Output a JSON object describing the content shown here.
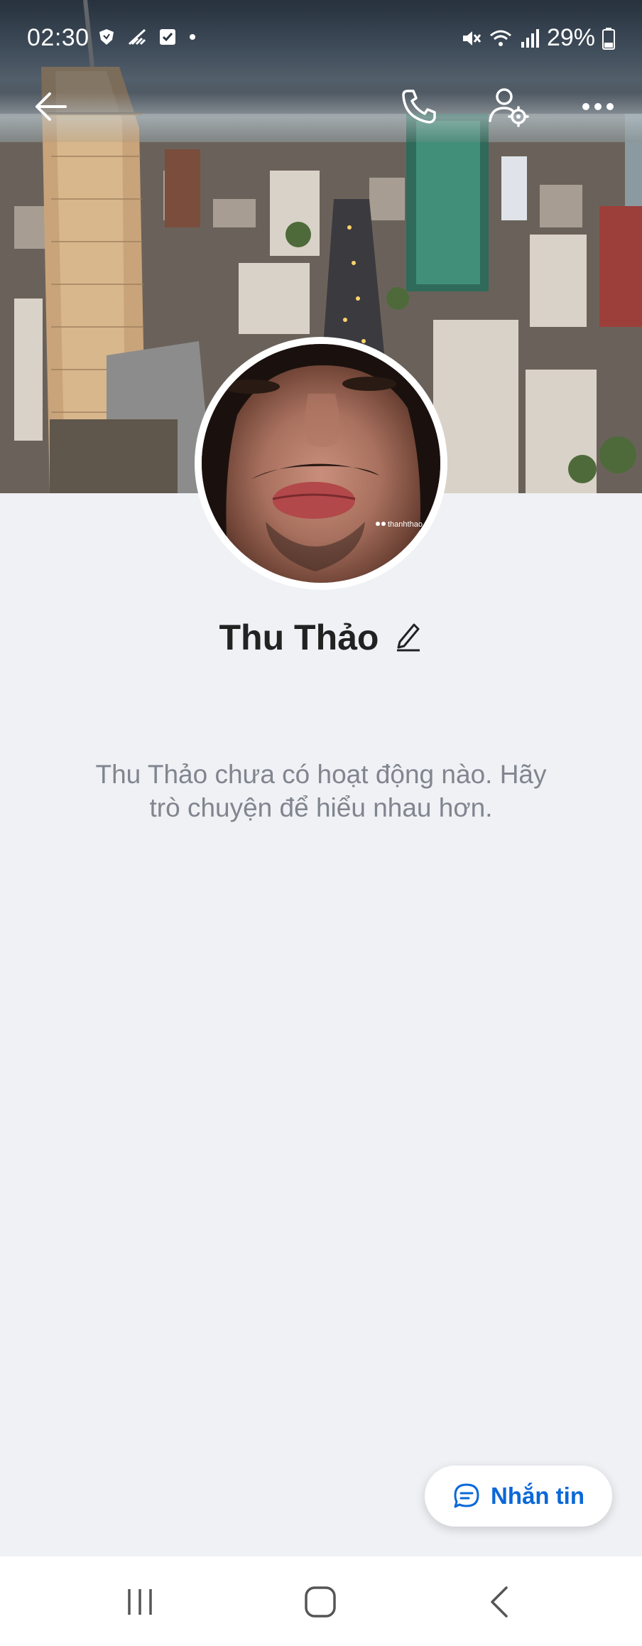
{
  "status_bar": {
    "time": "02:30",
    "battery": "29%",
    "icons": [
      "shield-icon",
      "signal-slash-icon",
      "checkbox-icon",
      "dot-icon",
      "mute-icon",
      "wifi-icon",
      "cell-signal-icon",
      "battery-icon"
    ]
  },
  "app_bar": {
    "icons": [
      "back-arrow-icon",
      "phone-icon",
      "user-settings-icon",
      "more-icon"
    ]
  },
  "profile": {
    "name": "Thu Thảo",
    "avatar_watermark": "thanhthao",
    "empty_state": "Thu Thảo chưa có hoạt động nào. Hãy trò chuyện để hiểu nhau hơn."
  },
  "actions": {
    "message_label": "Nhắn tin"
  },
  "nav": {
    "icons": [
      "recent-apps-icon",
      "home-icon",
      "back-icon"
    ]
  },
  "colors": {
    "accent": "#0a68d8",
    "background": "#eff1f5"
  }
}
